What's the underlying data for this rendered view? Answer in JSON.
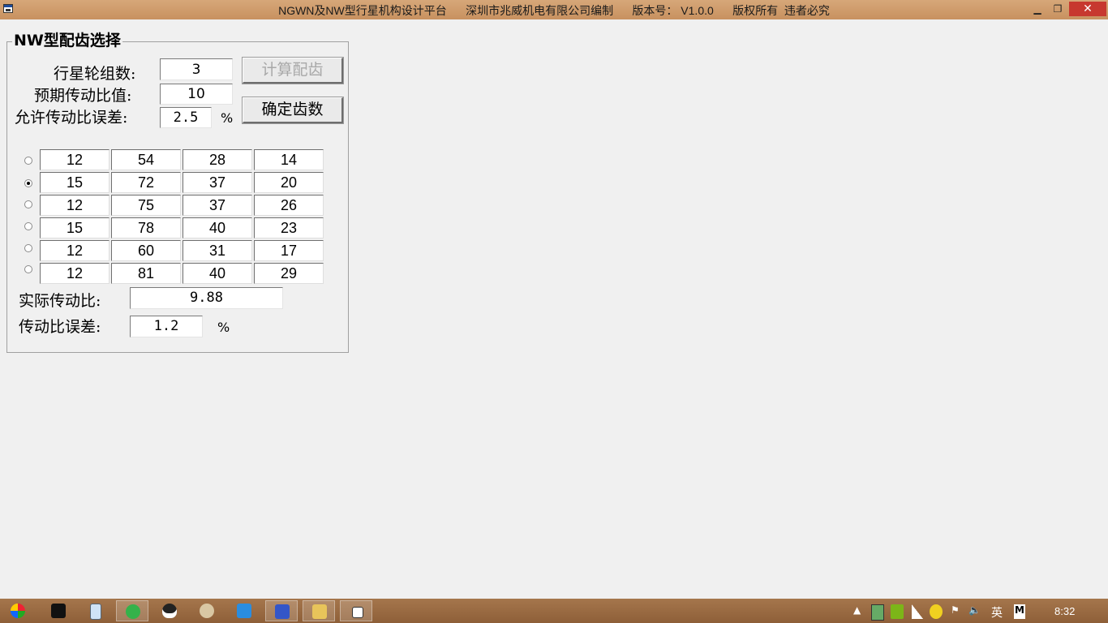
{
  "window": {
    "title": "NGWN及NW型行星机构设计平台      深圳市兆威机电有限公司编制      版本号： V1.0.0      版权所有  违者必究",
    "min_glyph": "▁",
    "restore_glyph": "❐",
    "close_glyph": "✕"
  },
  "group": {
    "title": "NW型配齿选择"
  },
  "inputs": {
    "planet_count_label": "行星轮组数:",
    "planet_count_value": "3",
    "expected_ratio_label": "预期传动比值:",
    "expected_ratio_value": "10",
    "tolerance_label": "允许传动比误差:",
    "tolerance_value": "2.5",
    "tolerance_unit": "%"
  },
  "buttons": {
    "calculate": "计算配齿",
    "confirm": "确定齿数"
  },
  "table": {
    "selected_index": 1,
    "rows": [
      [
        "12",
        "54",
        "28",
        "14"
      ],
      [
        "15",
        "72",
        "37",
        "20"
      ],
      [
        "12",
        "75",
        "37",
        "26"
      ],
      [
        "15",
        "78",
        "40",
        "23"
      ],
      [
        "12",
        "60",
        "31",
        "17"
      ],
      [
        "12",
        "81",
        "40",
        "29"
      ]
    ]
  },
  "results": {
    "actual_ratio_label": "实际传动比:",
    "actual_ratio_value": "9.88",
    "ratio_error_label": "传动比误差:",
    "ratio_error_value": "1.2",
    "ratio_error_unit": "%"
  },
  "taskbar": {
    "items": [
      "start-orb-icon",
      "norton-icon",
      "calculator-icon",
      "browser-icon",
      "qq-icon",
      "paint-icon",
      "chat-icon",
      "mail-icon",
      "file-explorer-icon",
      "app-window-icon"
    ],
    "ime": "英",
    "ime_mode": "M",
    "clock": "8:32"
  },
  "colors": {
    "titlebar": "#c8915f",
    "close": "#c7382f",
    "taskbar": "#8e5f38"
  }
}
